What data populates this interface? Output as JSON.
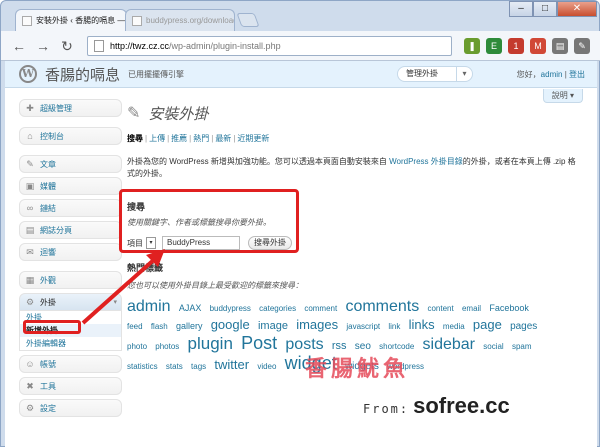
{
  "browser": {
    "tabs": [
      {
        "label": "安裝外掛 ‹ 香腸的嗝息 —…",
        "active": true
      },
      {
        "label": "buddypress.org/download",
        "active": false
      }
    ],
    "url_host": "http://twz.cz.cc",
    "url_path": "/wp-admin/plugin-install.php",
    "tab_close": "×",
    "window_controls": {
      "minimize": "–",
      "maximize": "□",
      "close": "✕"
    },
    "nav": {
      "back": "←",
      "forward": "→",
      "reload": "↻"
    },
    "extensions": [
      {
        "name": "bookmark-icon",
        "glyph": "❚",
        "color": "#6a9c2e"
      },
      {
        "name": "evernote-icon",
        "glyph": "E",
        "color": "#2e8b3a"
      },
      {
        "name": "feedly-icon",
        "glyph": "1",
        "color": "#c43b2e"
      },
      {
        "name": "gmail-icon",
        "glyph": "M",
        "color": "#d14836"
      },
      {
        "name": "page-menu-icon",
        "glyph": "▤",
        "color": "#777777"
      },
      {
        "name": "wrench-icon",
        "glyph": "✎",
        "color": "#777777"
      }
    ]
  },
  "wp": {
    "logo": "W",
    "site_title": "香腸的嗝息",
    "site_sub": "已用擺擺傳引擎",
    "fav_actions": "管理外掛",
    "fav_caret": "▾",
    "user_greeting": "您好，",
    "user_name": "admin",
    "user_sep": " | ",
    "logout": "登出",
    "help": "說明 ▾",
    "menu": [
      {
        "icon": "✚",
        "label": "超級管理",
        "name": "super-admin"
      },
      {
        "icon": "⌂",
        "label": "控制台",
        "name": "dashboard"
      },
      {
        "icon": "✎",
        "label": "文章",
        "name": "posts"
      },
      {
        "icon": "▣",
        "label": "媒體",
        "name": "media"
      },
      {
        "icon": "∞",
        "label": "鏈結",
        "name": "links"
      },
      {
        "icon": "▤",
        "label": "網誌分頁",
        "name": "pages"
      },
      {
        "icon": "✉",
        "label": "迴響",
        "name": "comments"
      },
      {
        "icon": "▦",
        "label": "外觀",
        "name": "appearance"
      }
    ],
    "plugins_menu": {
      "icon": "⚙",
      "label": "外掛",
      "toggle": "▾",
      "sub": [
        "外掛",
        "新增外掛",
        "外掛編輯器"
      ]
    },
    "menu_bottom": [
      {
        "icon": "☺",
        "label": "帳號",
        "name": "users"
      },
      {
        "icon": "✖",
        "label": "工具",
        "name": "tools"
      },
      {
        "icon": "⚙",
        "label": "設定",
        "name": "settings"
      }
    ]
  },
  "main": {
    "title": "安裝外掛",
    "title_icon": "✎",
    "subsub": [
      {
        "label": "搜尋",
        "current": true
      },
      {
        "label": "上傳",
        "current": false
      },
      {
        "label": "推薦",
        "current": false
      },
      {
        "label": "熱門",
        "current": false
      },
      {
        "label": "最新",
        "current": false
      },
      {
        "label": "近期更新",
        "current": false
      }
    ],
    "intro_before": "外掛為您的 WordPress 新增與加強功能。您可以透過本頁面自動安裝來自 ",
    "intro_link": "WordPress 外掛目錄",
    "intro_after": "的外掛，或者在本頁上傳 .zip 格式的外掛。",
    "search": {
      "heading": "搜尋",
      "hint": "使用關鍵字、作者或標籤搜尋你要外掛。",
      "type_label": "項目",
      "type_caret": "▾",
      "query": "BuddyPress",
      "button": "搜尋外掛"
    },
    "tags": {
      "heading": "熱門標籤",
      "hint": "您也可以使用外掛目錄上最受歡迎的標籤來搜尋：",
      "items": [
        {
          "t": "admin",
          "s": 16
        },
        {
          "t": "AJAX",
          "s": 9
        },
        {
          "t": "buddypress",
          "s": 8
        },
        {
          "t": "categories",
          "s": 8
        },
        {
          "t": "comment",
          "s": 8
        },
        {
          "t": "comments",
          "s": 16
        },
        {
          "t": "content",
          "s": 8
        },
        {
          "t": "email",
          "s": 8
        },
        {
          "t": "Facebook",
          "s": 9
        },
        {
          "t": "feed",
          "s": 8
        },
        {
          "t": "flash",
          "s": 8
        },
        {
          "t": "gallery",
          "s": 9
        },
        {
          "t": "google",
          "s": 13
        },
        {
          "t": "image",
          "s": 11
        },
        {
          "t": "images",
          "s": 13
        },
        {
          "t": "javascript",
          "s": 8
        },
        {
          "t": "link",
          "s": 8
        },
        {
          "t": "links",
          "s": 13
        },
        {
          "t": "media",
          "s": 8
        },
        {
          "t": "page",
          "s": 13
        },
        {
          "t": "pages",
          "s": 10
        },
        {
          "t": "photo",
          "s": 8
        },
        {
          "t": "photos",
          "s": 8
        },
        {
          "t": "plugin",
          "s": 17
        },
        {
          "t": "Post",
          "s": 18
        },
        {
          "t": "posts",
          "s": 16
        },
        {
          "t": "rss",
          "s": 11
        },
        {
          "t": "seo",
          "s": 10
        },
        {
          "t": "shortcode",
          "s": 8
        },
        {
          "t": "sidebar",
          "s": 16
        },
        {
          "t": "social",
          "s": 8
        },
        {
          "t": "spam",
          "s": 8
        },
        {
          "t": "statistics",
          "s": 8
        },
        {
          "t": "stats",
          "s": 8
        },
        {
          "t": "tags",
          "s": 8
        },
        {
          "t": "twitter",
          "s": 13
        },
        {
          "t": "video",
          "s": 8
        },
        {
          "t": "widget",
          "s": 18
        },
        {
          "t": "widgets",
          "s": 10
        },
        {
          "t": "wordpress",
          "s": 8
        }
      ]
    }
  },
  "watermark": {
    "cn": "香腸魷魚",
    "from": "From:",
    "site": "sofree.cc"
  },
  "colors": {
    "highlight": "#e02020",
    "link": "#21759b",
    "header_bg": "#e4f2fd"
  }
}
